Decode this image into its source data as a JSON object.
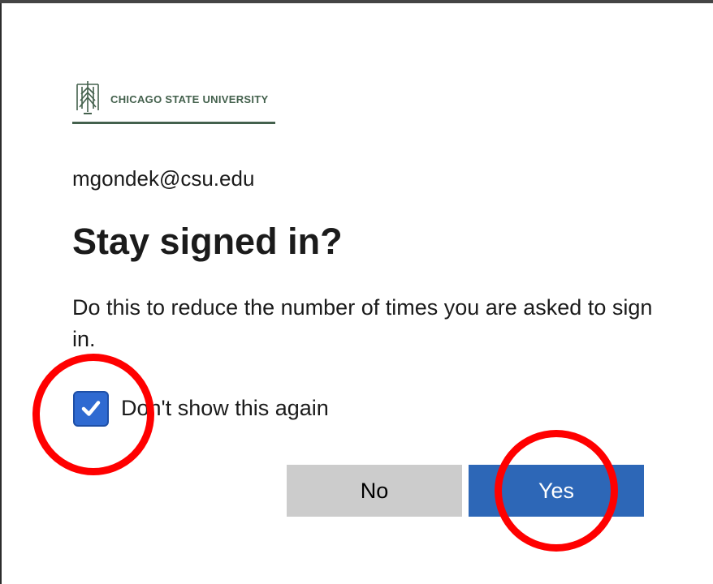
{
  "brand": {
    "name": "CHICAGO STATE UNIVERSITY",
    "logo_icon": "csu-tree-logo-icon",
    "color": "#44614d"
  },
  "account": {
    "email": "mgondek@csu.edu"
  },
  "dialog": {
    "title": "Stay signed in?",
    "description": "Do this to reduce the number of times you are asked to sign in.",
    "checkbox": {
      "label": "Don't show this again",
      "checked": true,
      "color": "#2f6ad1"
    },
    "buttons": {
      "no_label": "No",
      "yes_label": "Yes",
      "no_color": "#cccccc",
      "yes_color": "#2d67b7"
    }
  },
  "annotations": {
    "color": "#ff0000",
    "shape": "circle",
    "targets": [
      "checkbox",
      "yes-button"
    ]
  }
}
